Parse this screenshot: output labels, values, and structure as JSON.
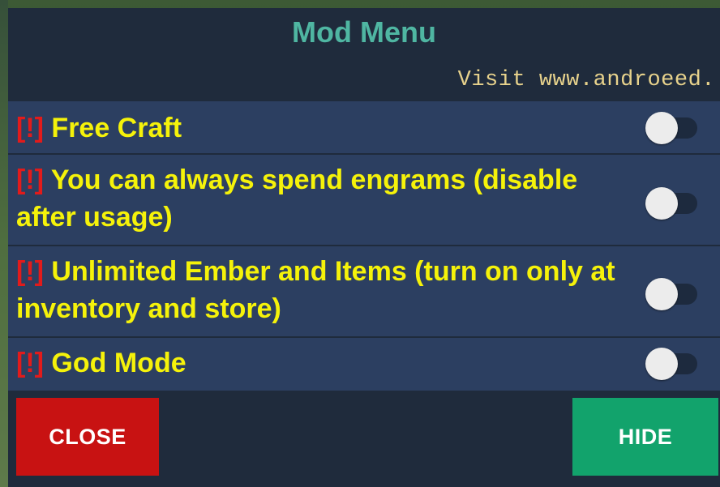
{
  "menu": {
    "title": "Mod Menu",
    "subtitle": "Visit www.androeed."
  },
  "options": [
    {
      "warn": "[!]",
      "label": "Free Craft",
      "enabled": false
    },
    {
      "warn": "[!]",
      "label": "You can always spend engrams (disable after usage)",
      "enabled": false
    },
    {
      "warn": "[!]",
      "label": "Unlimited Ember and Items (turn on only at inventory and store)",
      "enabled": false
    },
    {
      "warn": "[!]",
      "label": "God Mode",
      "enabled": false
    }
  ],
  "buttons": {
    "close_label": "CLOSE",
    "hide_label": "HIDE"
  },
  "colors": {
    "title": "#4fb6a2",
    "subtitle": "#e7d28c",
    "option_text": "#f5f20a",
    "warning": "#e21b1b",
    "panel_bg": "#1f2b3c",
    "row_bg": "#2c3f61",
    "close_button": "#c81212",
    "hide_button": "#12a36c"
  }
}
